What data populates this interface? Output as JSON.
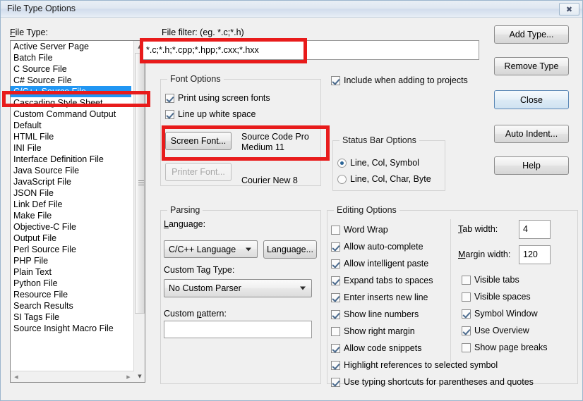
{
  "window": {
    "title": "File Type Options",
    "close_icon": "close-x-icon"
  },
  "file_type": {
    "label": "File Type:",
    "items": [
      "Active Server Page",
      "Batch File",
      "C Source File",
      "C# Source File",
      "C/C++ Source File",
      "Cascading Style Sheet",
      "Custom Command Output",
      "Default",
      "HTML File",
      "INI File",
      "Interface Definition File",
      "Java Source File",
      "JavaScript File",
      "JSON File",
      "Link Def File",
      "Make File",
      "Objective-C File",
      "Output File",
      "Perl Source File",
      "PHP File",
      "Plain Text",
      "Python File",
      "Resource File",
      "Search Results",
      "SI Tags File",
      "Source Insight Macro File"
    ],
    "selected": "C/C++ Source File",
    "selected_index": 4,
    "scroll_up_icon": "scroll-up-arrow-icon",
    "scroll_down_icon": "scroll-down-arrow-icon",
    "scroll_left_icon": "scroll-left-arrow-icon",
    "scroll_right_icon": "scroll-right-arrow-icon"
  },
  "file_filter": {
    "label": "File filter: (eg. *.c;*.h)",
    "value": "*.c;*.h;*.cpp;*.hpp;*.cxx;*.hxx",
    "placeholder": ""
  },
  "include_projects": {
    "label": "Include when adding to projects",
    "checked": true
  },
  "font_options": {
    "title": "Font Options",
    "print_screen_fonts": {
      "label": "Print using screen fonts",
      "checked": true
    },
    "line_up_white_space": {
      "label": "Line up white space",
      "checked": true
    },
    "screen_font_button": "Screen Font...",
    "screen_font_value": "Source Code Pro Medium 11",
    "printer_font_button": "Printer Font...",
    "printer_font_value": "Courier New 8",
    "printer_font_disabled": true
  },
  "status_bar_options": {
    "title": "Status Bar Options",
    "options": [
      {
        "label": "Line, Col, Symbol",
        "selected": true
      },
      {
        "label": "Line, Col, Char, Byte",
        "selected": false
      }
    ]
  },
  "parsing": {
    "title": "Parsing",
    "language_label": "Language:",
    "language_value": "C/C++ Language",
    "language_button": "Language...",
    "custom_tag_label": "Custom Tag Type:",
    "custom_tag_value": "No Custom Parser",
    "custom_pattern_label": "Custom pattern:",
    "custom_pattern_value": ""
  },
  "editing_options": {
    "title": "Editing Options",
    "left_column": [
      {
        "label": "Word Wrap",
        "checked": false
      },
      {
        "label": "Allow auto-complete",
        "checked": true
      },
      {
        "label": "Allow intelligent paste",
        "checked": true
      },
      {
        "label": "Expand tabs to spaces",
        "checked": true
      },
      {
        "label": "Enter inserts new line",
        "checked": true
      },
      {
        "label": "Show line numbers",
        "checked": true
      },
      {
        "label": "Show right margin",
        "checked": false
      },
      {
        "label": "Allow code snippets",
        "checked": true
      }
    ],
    "right_column": [
      {
        "label": "Visible tabs",
        "checked": false
      },
      {
        "label": "Visible spaces",
        "checked": false
      },
      {
        "label": "Symbol Window",
        "checked": true
      },
      {
        "label": "Use Overview",
        "checked": true
      },
      {
        "label": "Show page breaks",
        "checked": false
      }
    ],
    "full_width": [
      {
        "label": "Highlight references to selected symbol",
        "checked": true
      },
      {
        "label": "Use typing shortcuts for parentheses and quotes",
        "checked": true
      }
    ],
    "tab_width_label": "Tab width:",
    "tab_width_value": "4",
    "margin_width_label": "Margin width:",
    "margin_width_value": "120"
  },
  "buttons": {
    "add_type": "Add Type...",
    "remove_type": "Remove Type",
    "close": "Close",
    "auto_indent": "Auto Indent...",
    "help": "Help"
  },
  "annotations": {
    "accent_color": "#e81b1b",
    "highlight_color": "#2196f3"
  }
}
